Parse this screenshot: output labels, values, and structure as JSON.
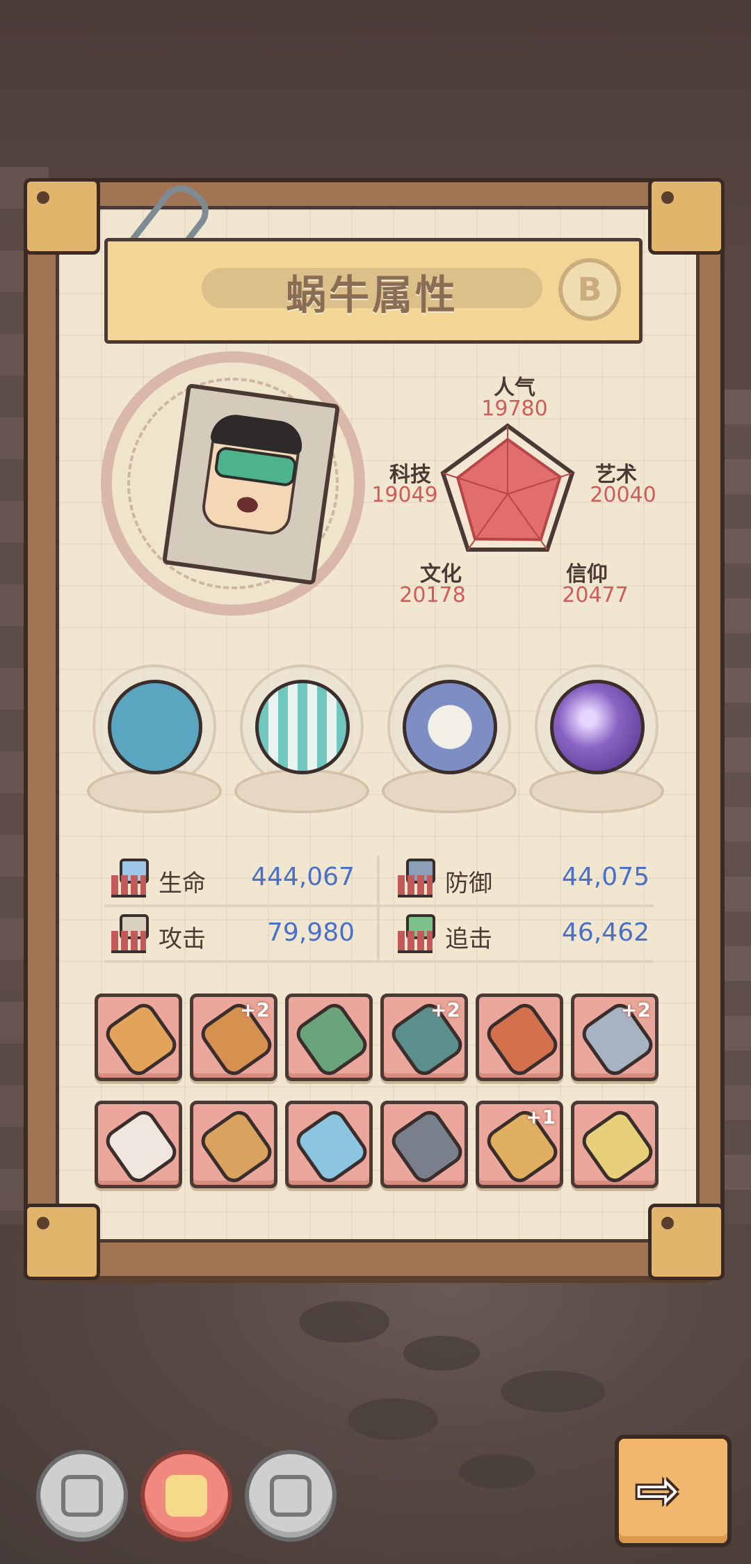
{
  "panel": {
    "title": "蜗牛属性",
    "grade": "B"
  },
  "attributes": [
    {
      "key": "popularity",
      "label": "人气",
      "value": "19780"
    },
    {
      "key": "art",
      "label": "艺术",
      "value": "20040"
    },
    {
      "key": "faith",
      "label": "信仰",
      "value": "20477"
    },
    {
      "key": "culture",
      "label": "文化",
      "value": "20178"
    },
    {
      "key": "tech",
      "label": "科技",
      "value": "19049"
    }
  ],
  "equipment_globes": [
    {
      "name": "monster-artifact",
      "color": "#5aa6c0"
    },
    {
      "name": "plaid-shirt",
      "color": "#6fc7c0"
    },
    {
      "name": "compass",
      "color": "#7c8ec4"
    },
    {
      "name": "galaxy-orb",
      "color": "#8a64c4"
    }
  ],
  "combat_stats": [
    {
      "label": "生命",
      "value": "444,067",
      "icon": "health-icon"
    },
    {
      "label": "防御",
      "value": "44,075",
      "icon": "defense-icon"
    },
    {
      "label": "攻击",
      "value": "79,980",
      "icon": "attack-icon"
    },
    {
      "label": "追击",
      "value": "46,462",
      "icon": "pursuit-icon"
    }
  ],
  "gear_slots": [
    {
      "icon": "torch-icon",
      "plus": ""
    },
    {
      "icon": "bola-icon",
      "plus": "+2"
    },
    {
      "icon": "hammer-icon",
      "plus": ""
    },
    {
      "icon": "trident-icon",
      "plus": "+2"
    },
    {
      "icon": "bullet-icon",
      "plus": ""
    },
    {
      "icon": "dagger-icon",
      "plus": "+2"
    },
    {
      "icon": "armor-icon",
      "plus": ""
    },
    {
      "icon": "ring-icon",
      "plus": ""
    },
    {
      "icon": "sword-icon",
      "plus": ""
    },
    {
      "icon": "gauntlet-icon",
      "plus": ""
    },
    {
      "icon": "robot-icon",
      "plus": "+1"
    },
    {
      "icon": "axe-icon",
      "plus": ""
    }
  ],
  "bottom_tabs": [
    {
      "icon": "face-icon",
      "active": false
    },
    {
      "icon": "chip-icon",
      "active": true
    },
    {
      "icon": "brain-icon",
      "active": false
    }
  ],
  "next_button": {
    "icon": "arrow-right-icon",
    "glyph": "⇨"
  }
}
